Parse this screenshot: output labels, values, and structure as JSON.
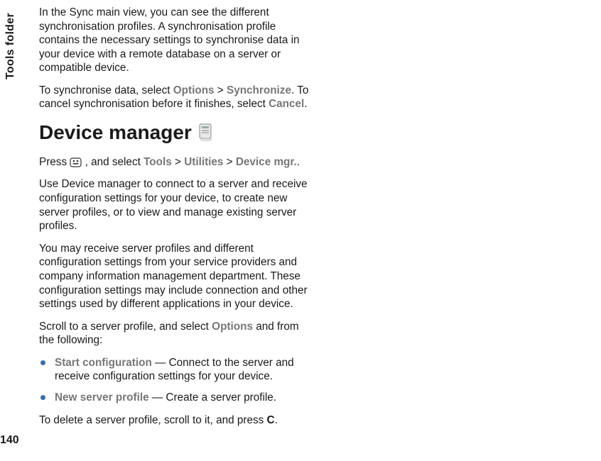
{
  "sideTab": "Tools folder",
  "pageNumber": "140",
  "col1": {
    "p1": "In the Sync main view, you can see the different synchronisation profiles. A synchronisation profile contains the necessary settings to synchronise data in your device with a remote database on a server or compatible device.",
    "p2a": "To synchronise data, select ",
    "p2_opt": "Options",
    "p2_gt": " > ",
    "p2_sync": "Synchronize",
    "p2b": ". To cancel synchronisation before it finishes, select ",
    "p2_cancel": "Cancel",
    "p2c": ".",
    "h1": "Device manager",
    "p3a": "Press ",
    "p3b": " , and select ",
    "p3_tools": "Tools",
    "p3_gt1": " > ",
    "p3_util": "Utilities",
    "p3_gt2": " > ",
    "p3_dev": "Device mgr.",
    "p3c": ".",
    "p4": "Use Device manager to connect to a server and receive configuration settings for your device, to create new server profiles, or to view and manage existing server profiles.",
    "p5": "You may receive server profiles and different configuration settings from your service providers and company information management department. These configuration settings may include connection and other settings used by different applications in your device.",
    "p6a": "Scroll to a server profile, and select ",
    "p6_opt": "Options",
    "p6b": " and from the following:",
    "b1_label": "Start configuration",
    "b1_text": " — Connect to the server and receive configuration settings for your device."
  },
  "col2": {
    "b2_label": "New server profile",
    "b2_text": " — Create a server profile.",
    "p7a": "To delete a server profile, scroll to it, and press ",
    "p7_key": "C",
    "p7b": "."
  }
}
